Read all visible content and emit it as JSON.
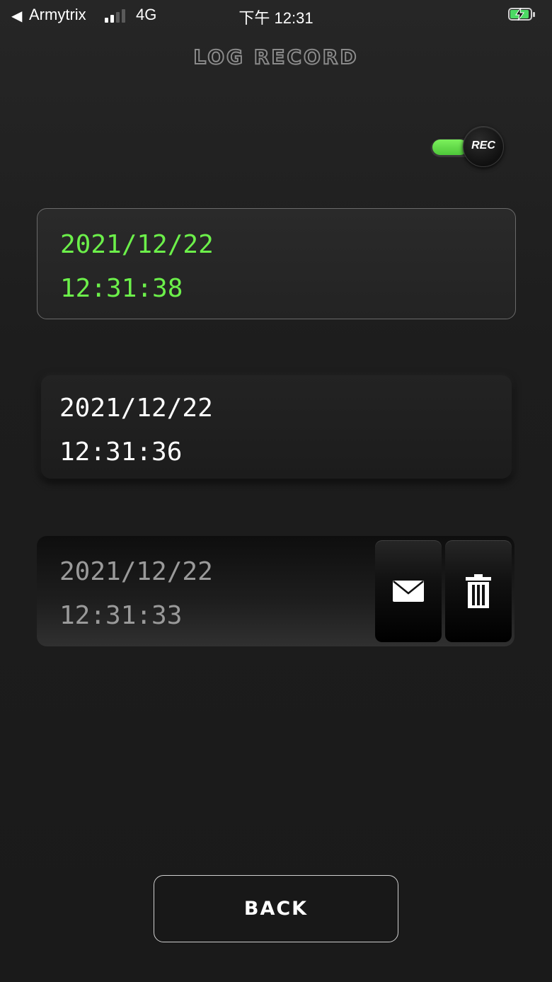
{
  "status_bar": {
    "back_glyph": "◀",
    "carrier": "Armytrix",
    "network": "4G",
    "time": "下午 12:31",
    "battery_color": "#4cd964"
  },
  "header": {
    "title": "LOG RECORD"
  },
  "rec_toggle": {
    "label": "REC",
    "state": "on",
    "on_color": "#6cf04a"
  },
  "logs": [
    {
      "date": "2021/12/22",
      "time": "12:31:38",
      "state": "active"
    },
    {
      "date": "2021/12/22",
      "time": "12:31:36",
      "state": "normal"
    },
    {
      "date": "2021/12/22",
      "time": "12:31:33",
      "state": "swiped"
    }
  ],
  "row_actions": {
    "mail_icon": "mail-icon",
    "trash_icon": "trash-icon"
  },
  "footer": {
    "back_label": "BACK"
  },
  "colors": {
    "accent_green": "#6cf04a",
    "background": "#1b1b1b"
  }
}
